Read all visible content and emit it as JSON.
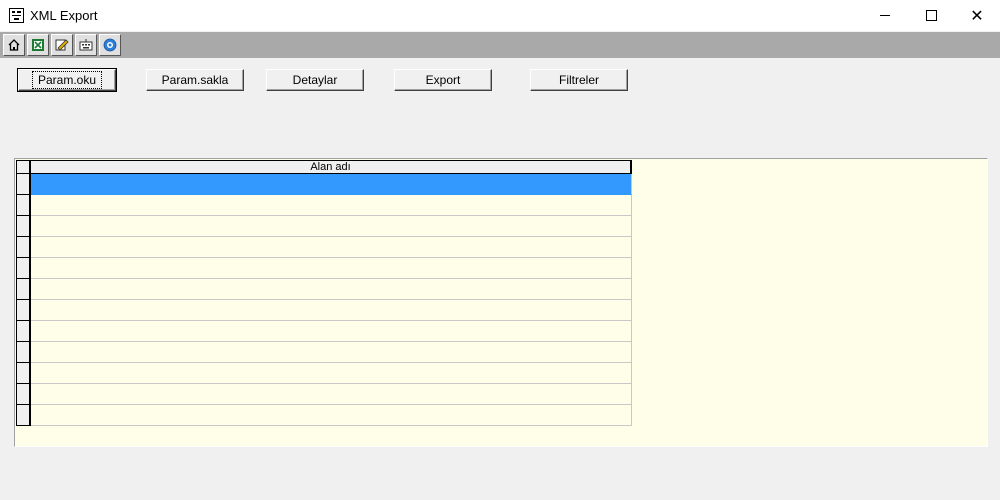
{
  "window": {
    "title": "XML Export",
    "controls": {
      "minimize": "minimize",
      "maximize": "maximize",
      "close": "✕"
    }
  },
  "toolbar": {
    "items": [
      {
        "icon": "home-icon",
        "color": "#000000"
      },
      {
        "icon": "excel-icon",
        "color": "#1d7a33"
      },
      {
        "icon": "edit-icon",
        "color": "#c8a000"
      },
      {
        "icon": "keyboard-icon",
        "color": "#404040"
      },
      {
        "icon": "help-icon",
        "color": "#2f7fd8"
      }
    ],
    "background": "#a9a9a9"
  },
  "buttons": {
    "param_oku": "Param.oku",
    "param_sakla": "Param.sakla",
    "detaylar": "Detaylar",
    "export": "Export",
    "filtreler": "Filtreler"
  },
  "grid": {
    "columns": [
      "Alan adı"
    ],
    "rows": [
      "",
      "",
      "",
      "",
      "",
      "",
      "",
      "",
      "",
      "",
      "",
      ""
    ],
    "selected_row": 0,
    "colors": {
      "selection": "#3399ff",
      "background": "#fffee8"
    }
  }
}
